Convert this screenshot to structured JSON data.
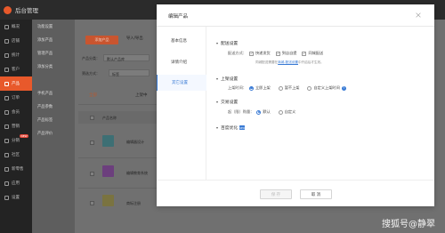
{
  "app": {
    "title": "后台管理"
  },
  "sidebar": {
    "items": [
      {
        "label": "概况"
      },
      {
        "label": "店铺"
      },
      {
        "label": "统计"
      },
      {
        "label": "客户"
      },
      {
        "label": "产品"
      },
      {
        "label": "订单"
      },
      {
        "label": "会员"
      },
      {
        "label": "营销"
      },
      {
        "label": "分销"
      },
      {
        "label": "社区"
      },
      {
        "label": "新零售"
      },
      {
        "label": "应用"
      },
      {
        "label": "设置"
      }
    ],
    "active_index": 4,
    "badge": "NEW"
  },
  "subnav": {
    "items": [
      "功能设置",
      "添加产品",
      "管理产品",
      "添加分类",
      "",
      "手机产品",
      "产品参数",
      "产品标签",
      "产品评价"
    ]
  },
  "background": {
    "add_button": "添加产品",
    "import_button": "导入/导出",
    "filter1_label": "产品分类：",
    "filter1_value": "默认产品库",
    "filter2_label": "筛选方式：",
    "filter2_value": "标签",
    "tab_all": "全部",
    "tab_onsale": "上架中",
    "col_name": "产品名称",
    "rows": [
      "编辑器设计",
      "编辑教育系统",
      "商标注册"
    ]
  },
  "modal": {
    "title": "编辑产品",
    "tabs": [
      "基本信息",
      "详情介绍",
      "其它设置"
    ],
    "active_tab": 2,
    "delivery": {
      "section": "配送设置",
      "label": "配送方式：",
      "options": [
        "快递发货",
        "到店自提",
        "同城配送"
      ],
      "hint_prefix": "同城配送需要在",
      "hint_link": "商城-配送设置",
      "hint_suffix": "中开启后才生效。"
    },
    "shelf": {
      "section": "上架设置",
      "label": "上架时间：",
      "options": [
        "立即上架",
        "暂不上架",
        "自定义上架时间"
      ],
      "selected": 0
    },
    "trade": {
      "section": "交易设置",
      "label": "起（限）购量：",
      "options": [
        "默认",
        "自定义"
      ],
      "selected": 0
    },
    "seo": {
      "section": "百度优化",
      "badge": "SEO"
    },
    "save": "保 存",
    "cancel": "取 消"
  },
  "watermark": "搜狐号@静翠"
}
